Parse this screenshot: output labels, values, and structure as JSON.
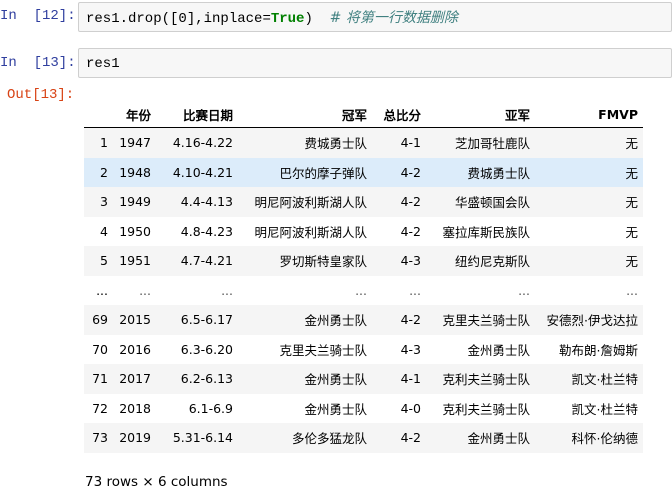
{
  "cells": [
    {
      "prompt": "In  [12]:",
      "code": {
        "prefix": "res1.drop([",
        "number": "0",
        "middle": "],inplace=",
        "keyword": "True",
        "suffix": ")",
        "comment": "# 将第一行数据删除"
      }
    },
    {
      "prompt": "In  [13]:",
      "code": {
        "text": "res1"
      }
    }
  ],
  "output": {
    "prompt": "Out[13]:",
    "columns": [
      "",
      "年份",
      "比赛日期",
      "冠军",
      "总比分",
      "亚军",
      "FMVP"
    ],
    "rows": [
      [
        "1",
        "1947",
        "4.16-4.22",
        "费城勇士队",
        "4-1",
        "芝加哥牡鹿队",
        "无"
      ],
      [
        "2",
        "1948",
        "4.10-4.21",
        "巴尔的摩子弹队",
        "4-2",
        "费城勇士队",
        "无"
      ],
      [
        "3",
        "1949",
        "4.4-4.13",
        "明尼阿波利斯湖人队",
        "4-2",
        "华盛顿国会队",
        "无"
      ],
      [
        "4",
        "1950",
        "4.8-4.23",
        "明尼阿波利斯湖人队",
        "4-2",
        "塞拉库斯民族队",
        "无"
      ],
      [
        "5",
        "1951",
        "4.7-4.21",
        "罗切斯特皇家队",
        "4-3",
        "纽约尼克斯队",
        "无"
      ],
      [
        "...",
        "...",
        "...",
        "...",
        "...",
        "...",
        "..."
      ],
      [
        "69",
        "2015",
        "6.5-6.17",
        "金州勇士队",
        "4-2",
        "克里夫兰骑士队",
        "安德烈·伊戈达拉"
      ],
      [
        "70",
        "2016",
        "6.3-6.20",
        "克里夫兰骑士队",
        "4-3",
        "金州勇士队",
        "勒布朗·詹姆斯"
      ],
      [
        "71",
        "2017",
        "6.2-6.13",
        "金州勇士队",
        "4-1",
        "克利夫兰骑士队",
        "凯文·杜兰特"
      ],
      [
        "72",
        "2018",
        "6.1-6.9",
        "金州勇士队",
        "4-0",
        "克利夫兰骑士队",
        "凯文·杜兰特"
      ],
      [
        "73",
        "2019",
        "5.31-6.14",
        "多伦多猛龙队",
        "4-2",
        "金州勇士队",
        "科怀·伦纳德"
      ]
    ],
    "shape_note": "73 rows × 6 columns"
  },
  "colors": {
    "in_prompt": "#303f9f",
    "out_prompt": "#d84315",
    "input_bg": "#f7f7f7",
    "input_border": "#cfcfcf",
    "keyword": "#008000",
    "comment": "#408080",
    "row_stripe": "#f5f5f5",
    "row_hover": "#dcecfa"
  }
}
